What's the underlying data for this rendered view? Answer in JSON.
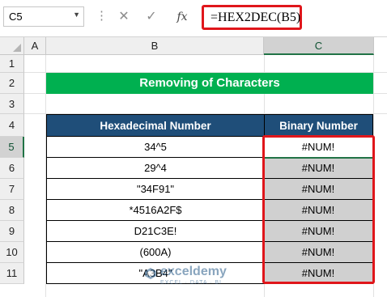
{
  "formula_bar": {
    "name_box": "C5",
    "cancel_glyph": "✕",
    "enter_glyph": "✓",
    "fx_label": "fx",
    "formula": "=HEX2DEC(B5)"
  },
  "columns": [
    "A",
    "B",
    "C"
  ],
  "rows": [
    "1",
    "2",
    "3",
    "4",
    "5",
    "6",
    "7",
    "8",
    "9",
    "10",
    "11"
  ],
  "title": "Removing of Characters",
  "table": {
    "headers": [
      "Hexadecimal Number",
      "Binary Number"
    ],
    "rows": [
      {
        "hex": "34^5",
        "binary": "#NUM!"
      },
      {
        "hex": "29^4",
        "binary": "#NUM!"
      },
      {
        "hex": "\"34F91\"",
        "binary": "#NUM!"
      },
      {
        "hex": "*4516A2F$",
        "binary": "#NUM!"
      },
      {
        "hex": "D21C3E!",
        "binary": "#NUM!"
      },
      {
        "hex": "(600A)",
        "binary": "#NUM!"
      },
      {
        "hex": "\"A3B4\"",
        "binary": "#NUM!"
      }
    ]
  },
  "watermark": {
    "name": "exceldemy",
    "tagline": "EXCEL · DATA · BI"
  },
  "colors": {
    "title_bg": "#00b050",
    "header_bg": "#1f4e79",
    "highlight": "#e0161b",
    "error_cell_bg": "#d0d0d0",
    "selection": "#217346"
  }
}
